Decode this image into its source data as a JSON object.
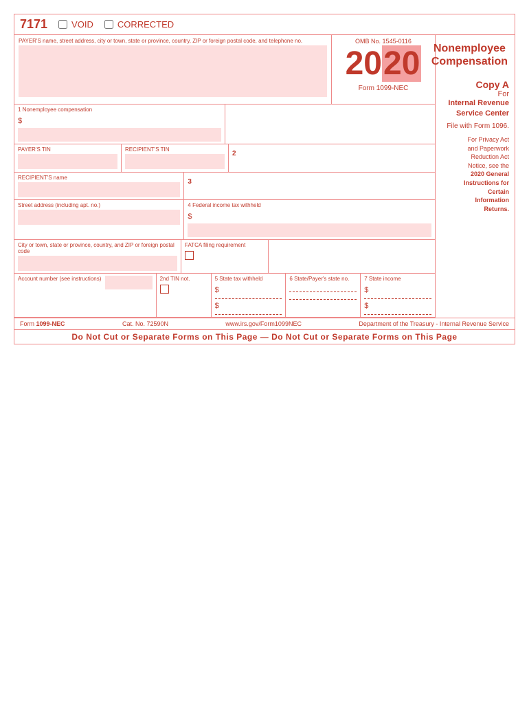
{
  "form": {
    "number": "7171",
    "void_label": "VOID",
    "corrected_label": "CORRECTED",
    "omb_number": "OMB No. 1545-0116",
    "year": "2020",
    "year_highlight": "20",
    "year_normal": "20",
    "form_name": "1099-NEC",
    "title_line1": "Nonemployee",
    "title_line2": "Compensation",
    "copy_label": "Copy A",
    "for_label": "For",
    "irs_line1": "Internal Revenue",
    "irs_line2": "Service Center",
    "file_with": "File with Form 1096.",
    "privacy_line1": "For Privacy Act",
    "privacy_line2": "and Paperwork",
    "privacy_line3": "Reduction Act",
    "privacy_line4": "Notice, see the",
    "privacy_line5": "2020 General",
    "privacy_line6": "Instructions for",
    "privacy_line7": "Certain",
    "privacy_line8": "Information",
    "privacy_line9": "Returns.",
    "payer_label": "PAYER'S name, street address, city or town, state or province, country, ZIP or foreign postal code, and telephone no.",
    "field1_label": "1 Nonemployee compensation",
    "dollar1": "$",
    "field2_label": "2",
    "payer_tin_label": "PAYER'S TIN",
    "recipient_tin_label": "RECIPIENT'S TIN",
    "recipient_name_label": "RECIPIENT'S name",
    "field3_label": "3",
    "street_label": "Street address (including apt. no.)",
    "field4_label": "4 Federal income tax withheld",
    "dollar4": "$",
    "city_label": "City or town, state or province, country, and ZIP or foreign postal code",
    "fatca_label": "FATCA filing requirement",
    "account_label": "Account number (see instructions)",
    "tin_2nd_label": "2nd TIN not.",
    "field5_label": "5 State tax withheld",
    "dollar5a": "$",
    "dollar5b": "$",
    "field6_label": "6 State/Payer's state no.",
    "field7_label": "7 State income",
    "dollar7a": "$",
    "dollar7b": "$",
    "footer_form": "Form 1099-NEC",
    "cat_no": "Cat. No. 72590N",
    "website": "www.irs.gov/Form1099NEC",
    "department": "Department of the Treasury - Internal Revenue Service",
    "do_not_cut": "Do Not Cut or Separate Forms on This Page  —  Do Not Cut or Separate Forms on This Page"
  }
}
